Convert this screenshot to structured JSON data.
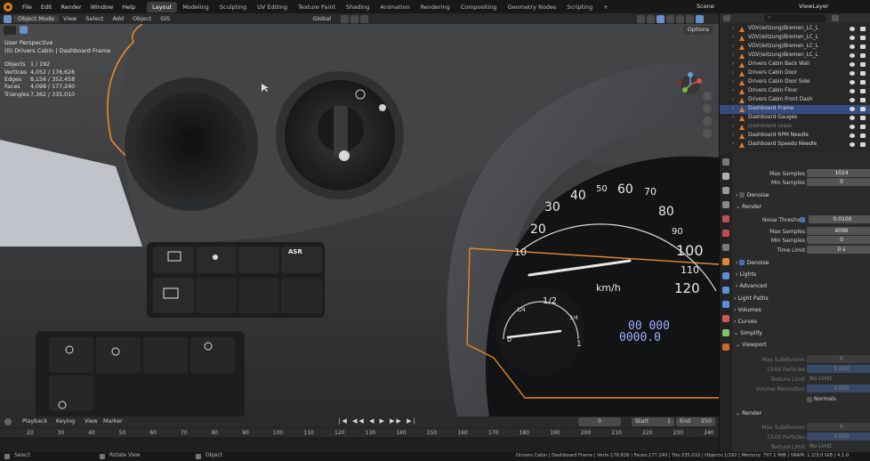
{
  "menubar": {
    "items": [
      "File",
      "Edit",
      "Render",
      "Window",
      "Help"
    ],
    "workspaces": [
      "Layout",
      "Modeling",
      "Sculpting",
      "UV Editing",
      "Texture Paint",
      "Shading",
      "Animation",
      "Rendering",
      "Compositing",
      "Geometry Nodes",
      "Scripting"
    ],
    "active_workspace": "Layout",
    "scene": "Scene",
    "view_layer": "ViewLayer"
  },
  "viewport_header": {
    "mode": "Object Mode",
    "menus": [
      "View",
      "Select",
      "Add",
      "Object",
      "GIS"
    ],
    "transform_orientation": "Global",
    "options_label": "Options"
  },
  "viewport_overlay": {
    "perspective": "User Perspective",
    "object_path": "(0) Drivers Cabin | Dashboard Frame",
    "stats": [
      {
        "label": "Objects",
        "value": "1 / 192"
      },
      {
        "label": "Vertices",
        "value": "4,052 / 176,626"
      },
      {
        "label": "Edges",
        "value": "8,156 / 352,458"
      },
      {
        "label": "Faces",
        "value": "4,098 / 177,240"
      },
      {
        "label": "Triangles",
        "value": "7,362 / 335,010"
      }
    ]
  },
  "scene_content": {
    "speedo_ticks": [
      "10",
      "20",
      "30",
      "40",
      "50",
      "60",
      "70",
      "80",
      "90",
      "100",
      "110",
      "120"
    ],
    "speed_unit": "km/h",
    "fuel_labels": [
      "0",
      "1/2",
      "1/4",
      "3/4",
      "1"
    ],
    "odometer_top": "00 000",
    "odometer_bottom": "0000.0",
    "switch_label": "ASR"
  },
  "outliner": {
    "rows": [
      {
        "label": "VDV(leitzung)Bremen_LC_L",
        "selected": false,
        "dim": false
      },
      {
        "label": "VDV(leitzung)Bremen_LC_L",
        "selected": false,
        "dim": false
      },
      {
        "label": "VDV(leitzung)Bremen_LC_L",
        "selected": false,
        "dim": false
      },
      {
        "label": "VDV(leitzung)Bremen_LC_L",
        "selected": false,
        "dim": false
      },
      {
        "label": "Drivers Cabin Back Wall",
        "selected": false,
        "dim": false
      },
      {
        "label": "Drivers Cabin Door",
        "selected": false,
        "dim": false
      },
      {
        "label": "Drivers Cabin Door Side",
        "selected": false,
        "dim": false
      },
      {
        "label": "Drivers Cabin Floor",
        "selected": false,
        "dim": false
      },
      {
        "label": "Drivers Cabin Front Dash",
        "selected": false,
        "dim": false
      },
      {
        "label": "Dashboard Frame",
        "selected": true,
        "dim": false
      },
      {
        "label": "Dashboard Gauges",
        "selected": false,
        "dim": false
      },
      {
        "label": "Dashboard Glass",
        "selected": false,
        "dim": true
      },
      {
        "label": "Dashboard RPM Needle",
        "selected": false,
        "dim": false
      },
      {
        "label": "Dashboard Speedo Needle",
        "selected": false,
        "dim": false
      }
    ]
  },
  "properties": {
    "max_samples_top": {
      "label": "Max Samples",
      "value": "1024"
    },
    "min_samples_top": {
      "label": "Min Samples",
      "value": "0"
    },
    "denoise_top": "Denoise",
    "render_section": "Render",
    "noise_threshold": {
      "label": "Noise Threshold",
      "value": "0.0100"
    },
    "max_samples": {
      "label": "Max Samples",
      "value": "4096"
    },
    "min_samples": {
      "label": "Min Samples",
      "value": "0"
    },
    "time_limit": {
      "label": "Time Limit",
      "value": "0 s"
    },
    "denoise": "Denoise",
    "lights": "Lights",
    "advanced": "Advanced",
    "light_paths": "Light Paths",
    "volumes": "Volumes",
    "curves": "Curves",
    "simplify": "Simplify",
    "viewport": "Viewport",
    "max_subdivision": {
      "label": "Max Subdivision",
      "value": "6"
    },
    "child_particles": {
      "label": "Child Particles",
      "value": "1.000"
    },
    "texture_limit": {
      "label": "Texture Limit",
      "value": "No Limit"
    },
    "volume_resolution": {
      "label": "Volume Resolution",
      "value": "1.000"
    },
    "normals": "Normals",
    "render_sub": "Render",
    "max_subdivision_r": {
      "label": "Max Subdivision",
      "value": "6"
    },
    "child_particles_r": {
      "label": "Child Particles",
      "value": "1.000"
    },
    "texture_limit_r": {
      "label": "Texture Limit",
      "value": "No Limit"
    }
  },
  "timeline": {
    "menus": [
      "Playback",
      "Keying",
      "View",
      "Marker"
    ],
    "current_frame": "0",
    "start_label": "Start",
    "start": "1",
    "end_label": "End",
    "end": "250",
    "ruler": [
      "20",
      "30",
      "40",
      "50",
      "60",
      "70",
      "80",
      "90",
      "100",
      "110",
      "120",
      "130",
      "140",
      "150",
      "160",
      "170",
      "180",
      "190",
      "200",
      "210",
      "220",
      "230",
      "240"
    ]
  },
  "statusbar": {
    "select": "Select",
    "rotate": "Rotate View",
    "object": "Object",
    "info": "Drivers Cabin | Dashboard Frame | Verts:176,626 | Faces:177,240 | Tris:335,010 | Objects:1/192 | Memory: 797.1 MiB | VRAM: 1.2/3.0 GiB | 4.1.0"
  }
}
